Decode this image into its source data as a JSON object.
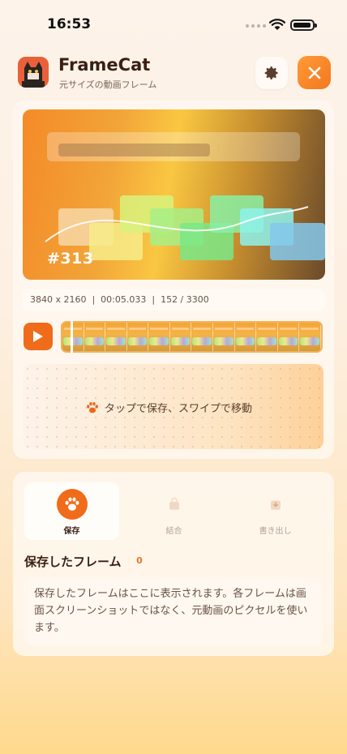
{
  "status_bar": {
    "time": "16:53"
  },
  "header": {
    "app_name": "FrameCat",
    "subtitle": "元サイズの動画フレーム",
    "settings_icon": "gear-icon",
    "close_icon": "close-icon"
  },
  "preview": {
    "frame_number": "#313",
    "meta": "3840 x 2160  |  00:05.033  |  152 / 3300"
  },
  "player": {
    "play_icon": "play-icon",
    "thumbnail_count": 12,
    "playhead_position": 0.04
  },
  "tap_zone": {
    "icon": "paw-icon",
    "label": "タップで保存、スワイプで移動"
  },
  "tabs": [
    {
      "label": "保存",
      "icon": "paw-icon",
      "active": true
    },
    {
      "label": "結合",
      "icon": "bag-icon",
      "active": false
    },
    {
      "label": "書き出し",
      "icon": "export-icon",
      "active": false
    }
  ],
  "saved": {
    "title": "保存したフレーム",
    "count": "0",
    "empty_text": "保存したフレームはここに表示されます。各フレームは画面スクリーンショットではなく、元動画のピクセルを使います。"
  },
  "colors": {
    "accent": "#f06b1a",
    "accent_light": "#ff9b35",
    "text_dark": "#3a1f12"
  }
}
